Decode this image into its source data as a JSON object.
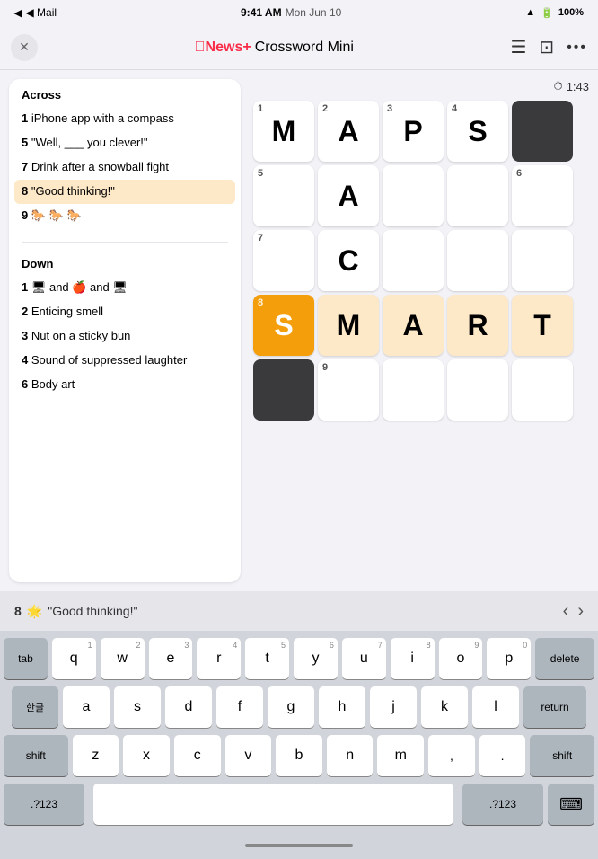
{
  "statusBar": {
    "back": "◀ Mail",
    "time": "9:41 AM",
    "date": "Mon Jun 10",
    "wifi": "WiFi",
    "battery": "100%"
  },
  "navBar": {
    "closeBtn": "✕",
    "logoText": "News+",
    "titleText": "Crossword Mini",
    "listIcon": "≡",
    "screenIcon": "⊡",
    "moreIcon": "···"
  },
  "timer": {
    "icon": "⏱",
    "value": "1:43"
  },
  "clues": {
    "acrossTitle": "Across",
    "downTitle": "Down",
    "acrossItems": [
      {
        "num": "1",
        "text": "iPhone app with a compass"
      },
      {
        "num": "5",
        "text": "\"Well, ___ you clever!\""
      },
      {
        "num": "7",
        "text": "Drink after a snowball fight"
      },
      {
        "num": "8",
        "text": "\"Good thinking!\"",
        "highlighted": true
      },
      {
        "num": "9",
        "text": "🐎 🐎 🐎"
      }
    ],
    "downItems": [
      {
        "num": "1",
        "text": "and 🍎 and 🖥",
        "hasEmoji": true
      },
      {
        "num": "2",
        "text": "Enticing smell"
      },
      {
        "num": "3",
        "text": "Nut on a sticky bun"
      },
      {
        "num": "4",
        "text": "Sound of suppressed laughter"
      },
      {
        "num": "6",
        "text": "Body art"
      }
    ]
  },
  "grid": {
    "cells": [
      {
        "row": 1,
        "col": 1,
        "num": "1",
        "letter": "M",
        "state": "filled"
      },
      {
        "row": 1,
        "col": 2,
        "num": "2",
        "letter": "A",
        "state": "filled"
      },
      {
        "row": 1,
        "col": 3,
        "num": "3",
        "letter": "P",
        "state": "filled"
      },
      {
        "row": 1,
        "col": 4,
        "num": "4",
        "letter": "S",
        "state": "filled"
      },
      {
        "row": 1,
        "col": 5,
        "num": "",
        "letter": "",
        "state": "black"
      },
      {
        "row": 2,
        "col": 1,
        "num": "5",
        "letter": "",
        "state": "empty"
      },
      {
        "row": 2,
        "col": 2,
        "num": "",
        "letter": "A",
        "state": "filled"
      },
      {
        "row": 2,
        "col": 3,
        "num": "",
        "letter": "",
        "state": "empty"
      },
      {
        "row": 2,
        "col": 4,
        "num": "",
        "letter": "",
        "state": "empty"
      },
      {
        "row": 2,
        "col": 5,
        "num": "6",
        "letter": "",
        "state": "empty"
      },
      {
        "row": 3,
        "col": 1,
        "num": "7",
        "letter": "",
        "state": "empty"
      },
      {
        "row": 3,
        "col": 2,
        "num": "",
        "letter": "C",
        "state": "filled"
      },
      {
        "row": 3,
        "col": 3,
        "num": "",
        "letter": "",
        "state": "empty"
      },
      {
        "row": 3,
        "col": 4,
        "num": "",
        "letter": "",
        "state": "empty"
      },
      {
        "row": 3,
        "col": 5,
        "num": "",
        "letter": "",
        "state": "empty"
      },
      {
        "row": 4,
        "col": 1,
        "num": "8",
        "letter": "S",
        "state": "active"
      },
      {
        "row": 4,
        "col": 2,
        "num": "",
        "letter": "M",
        "state": "highlighted"
      },
      {
        "row": 4,
        "col": 3,
        "num": "",
        "letter": "A",
        "state": "highlighted"
      },
      {
        "row": 4,
        "col": 4,
        "num": "",
        "letter": "R",
        "state": "highlighted"
      },
      {
        "row": 4,
        "col": 5,
        "num": "",
        "letter": "T",
        "state": "highlighted"
      },
      {
        "row": 5,
        "col": 1,
        "num": "",
        "letter": "",
        "state": "black"
      },
      {
        "row": 5,
        "col": 2,
        "num": "9",
        "letter": "",
        "state": "empty"
      },
      {
        "row": 5,
        "col": 3,
        "num": "",
        "letter": "",
        "state": "empty"
      },
      {
        "row": 5,
        "col": 4,
        "num": "",
        "letter": "",
        "state": "empty"
      },
      {
        "row": 5,
        "col": 5,
        "num": "",
        "letter": "",
        "state": "empty"
      }
    ]
  },
  "hintBar": {
    "clueRef": "8",
    "emoji": "🌟",
    "clueText": "\"Good thinking!\""
  },
  "keyboard": {
    "row1": [
      {
        "key": "q",
        "sup": "1"
      },
      {
        "key": "w",
        "sup": "2"
      },
      {
        "key": "e",
        "sup": "3"
      },
      {
        "key": "r",
        "sup": "4"
      },
      {
        "key": "t",
        "sup": "5"
      },
      {
        "key": "y",
        "sup": "6"
      },
      {
        "key": "u",
        "sup": "7"
      },
      {
        "key": "i",
        "sup": "8"
      },
      {
        "key": "o",
        "sup": "9"
      },
      {
        "key": "p",
        "sup": "0"
      }
    ],
    "row2": [
      {
        "key": "a",
        "sup": ""
      },
      {
        "key": "s",
        "sup": ""
      },
      {
        "key": "d",
        "sup": ""
      },
      {
        "key": "f",
        "sup": ""
      },
      {
        "key": "g",
        "sup": ""
      },
      {
        "key": "h",
        "sup": ""
      },
      {
        "key": "j",
        "sup": ""
      },
      {
        "key": "k",
        "sup": ""
      },
      {
        "key": "l",
        "sup": ""
      }
    ],
    "row3": [
      {
        "key": "z",
        "sup": ""
      },
      {
        "key": "x",
        "sup": ""
      },
      {
        "key": "c",
        "sup": ""
      },
      {
        "key": "v",
        "sup": ""
      },
      {
        "key": "b",
        "sup": ""
      },
      {
        "key": "n",
        "sup": ""
      },
      {
        "key": "m",
        "sup": ""
      },
      {
        "key": "!",
        "sup": ""
      },
      {
        "key": "?",
        "sup": ""
      }
    ],
    "tabLabel": "tab",
    "hangulLabel": "한글",
    "shiftLabel": "shift",
    "deleteLabel": "delete",
    "returnLabel": "return",
    "numLabel": ".?123",
    "numLabel2": ".?123",
    "keyboardIcon": "⌨"
  }
}
